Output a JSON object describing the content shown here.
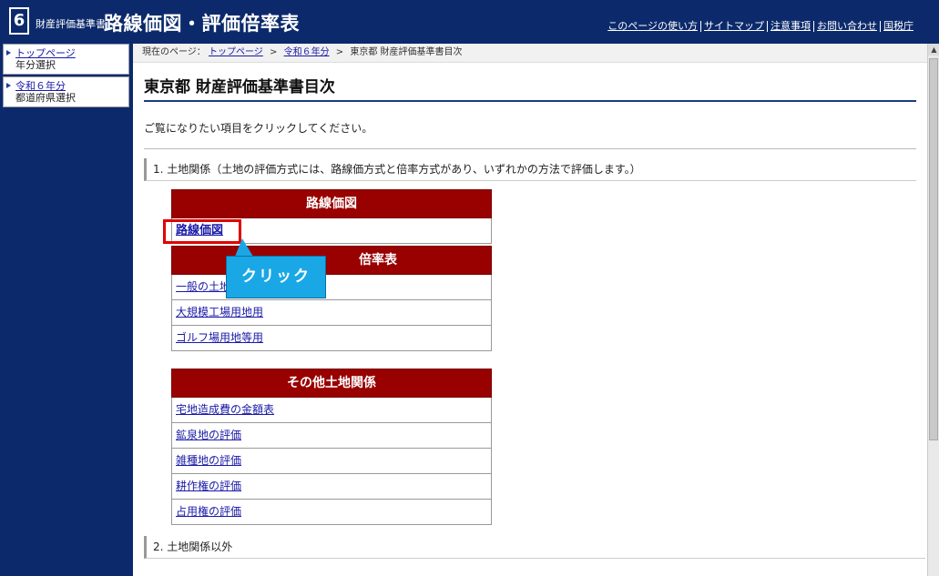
{
  "header": {
    "logo_number": "6",
    "logo_sub": "財産評価基準書",
    "title": "路線価図・評価倍率表",
    "nav": [
      "このページの使い方",
      "サイトマップ",
      "注意事項",
      "お問い合わせ",
      "国税庁"
    ]
  },
  "sidebar": {
    "items": [
      {
        "link": "トップページ",
        "sub": "年分選択"
      },
      {
        "link": "令和６年分",
        "sub": "都道府県選択"
      }
    ]
  },
  "breadcrumb": {
    "prefix": "現在のページ：",
    "items": [
      "トップページ",
      "令和６年分"
    ],
    "current": "東京都  財産評価基準書目次"
  },
  "page_title": "東京都  財産評価基準書目次",
  "intro": "ご覧になりたい項目をクリックしてください。",
  "section1": {
    "number": "1.",
    "title": "土地関係",
    "note": "（土地の評価方式には、路線価方式と倍率方式があり、いずれかの方法で評価します。）"
  },
  "groups": {
    "rosenka": {
      "header": "路線価図",
      "items": [
        "路線価図"
      ]
    },
    "bairitsu": {
      "header_partial": "倍率表",
      "items": [
        "一般の土地",
        "大規模工場用地用",
        "ゴルフ場用地等用"
      ]
    },
    "other": {
      "header": "その他土地関係",
      "items": [
        "宅地造成費の金額表",
        "鉱泉地の評価",
        "雑種地の評価",
        "耕作権の評価",
        "占用権の評価"
      ]
    }
  },
  "callout": {
    "text": "クリック",
    "color": "#1aa7e6"
  },
  "section2": {
    "number": "2.",
    "title": "土地関係以外"
  },
  "colors": {
    "header_bg": "#0c2a6b",
    "group_header": "#990000",
    "highlight": "#e00000"
  }
}
